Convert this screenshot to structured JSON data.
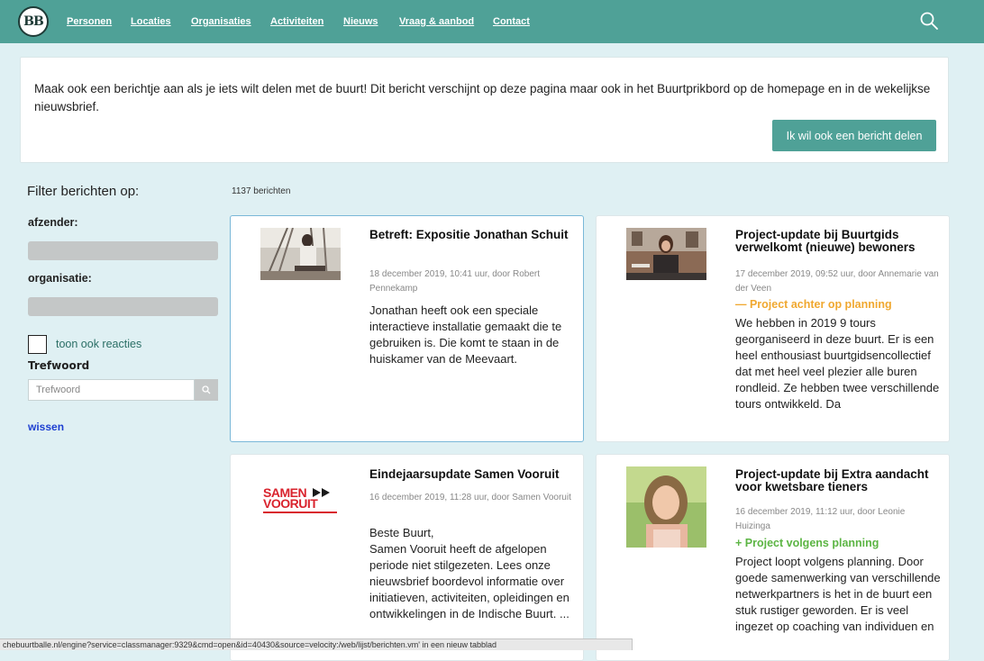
{
  "nav": {
    "logo": "BB",
    "links": [
      "Personen",
      "Locaties",
      "Organisaties",
      "Activiteiten",
      "Nieuws",
      "Vraag & aanbod",
      "Contact"
    ]
  },
  "intro": {
    "text": "Maak ook een berichtje aan als je iets wilt delen met de buurt! Dit bericht verschijnt op deze pagina maar ook in het Buurtprikbord op de homepage en in de wekelijkse nieuwsbrief.",
    "button": "Ik wil ook een bericht delen"
  },
  "filter": {
    "title": "Filter berichten op:",
    "sender_label": "afzender:",
    "org_label": "organisatie:",
    "reactions_label": "toon ook reacties",
    "keyword_label": "Trefwoord",
    "keyword_placeholder": "Trefwoord",
    "clear": "wissen"
  },
  "count": "1137 berichten",
  "posts": [
    {
      "title": "Betreft: Expositie Jonathan Schuit",
      "meta": "18 december 2019, 10:41 uur, door Robert Pennekamp",
      "status": "",
      "body": "Jonathan heeft ook een speciale interactieve installatie gemaakt die te gebruiken is. Die komt te staan in de huiskamer van de Meevaart."
    },
    {
      "title": "Project-update bij Buurtgids verwelkomt (nieuwe) bewoners",
      "meta": "17 december 2019, 09:52 uur, door Annemarie van der Veen",
      "status": "— Project achter op planning",
      "body": "We hebben in 2019 9 tours georganiseerd in deze buurt. Er is een heel enthousiast buurtgidsencollectief dat met heel veel plezier alle buren rondleid. Ze hebben twee verschillende tours ontwikkeld. Da"
    },
    {
      "title": "Eindejaarsupdate Samen Vooruit",
      "meta": "16 december 2019, 11:28 uur, door Samen Vooruit",
      "status": "",
      "logo_line1": "SAMEN",
      "logo_line2": "VOORUIT",
      "body": "Beste Buurt,\nSamen Vooruit heeft de afgelopen periode niet stilgezeten. Lees onze nieuwsbrief boordevol informatie over initiatieven, activiteiten, opleidingen en ontwikkelingen in de Indische Buurt. ..."
    },
    {
      "title": "Project-update bij Extra aandacht voor kwetsbare tieners",
      "meta": "16 december 2019, 11:12 uur, door Leonie Huizinga",
      "status": "+ Project volgens planning",
      "body": "Project loopt volgens planning. Door goede samenwerking van verschillende netwerkpartners is het in de buurt een stuk rustiger geworden. Er is veel ingezet op coaching van individuen en"
    }
  ],
  "colors": {
    "brand": "#4fa197",
    "status_behind": "#f0a830",
    "status_ok": "#5cb544",
    "link": "#1d3fd1"
  },
  "statusbar": "chebuurtballe.nl/engine?service=classmanager:9329&cmd=open&id=40430&source=velocity:/web/lijst/berichten.vm' in een nieuw tabblad"
}
